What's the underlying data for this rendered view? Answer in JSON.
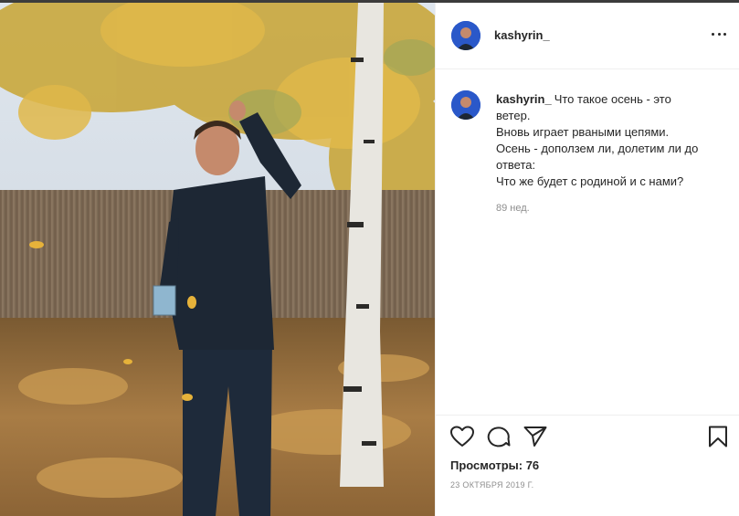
{
  "post": {
    "username": "kashyrin_",
    "caption_lines": [
      "Что такое осень - это",
      "ветер.",
      "Вновь играет рваными цепями.",
      "Осень - доползем ли, долетим ли до",
      "ответа:",
      "Что же будет с родиной и с нами?"
    ],
    "age": "89 нед.",
    "views_label": "Просмотры: 76",
    "date": "23 ОКТЯБРЯ 2019 Г."
  },
  "icons": {
    "like": "heart-icon",
    "comment": "speech-bubble-icon",
    "share": "paper-plane-icon",
    "save": "bookmark-icon",
    "more": "more-options-icon"
  },
  "colors": {
    "text": "#262626",
    "secondary_text": "#8e8e8e",
    "divider": "#efefef",
    "avatar_bg": "#2a58c9"
  }
}
